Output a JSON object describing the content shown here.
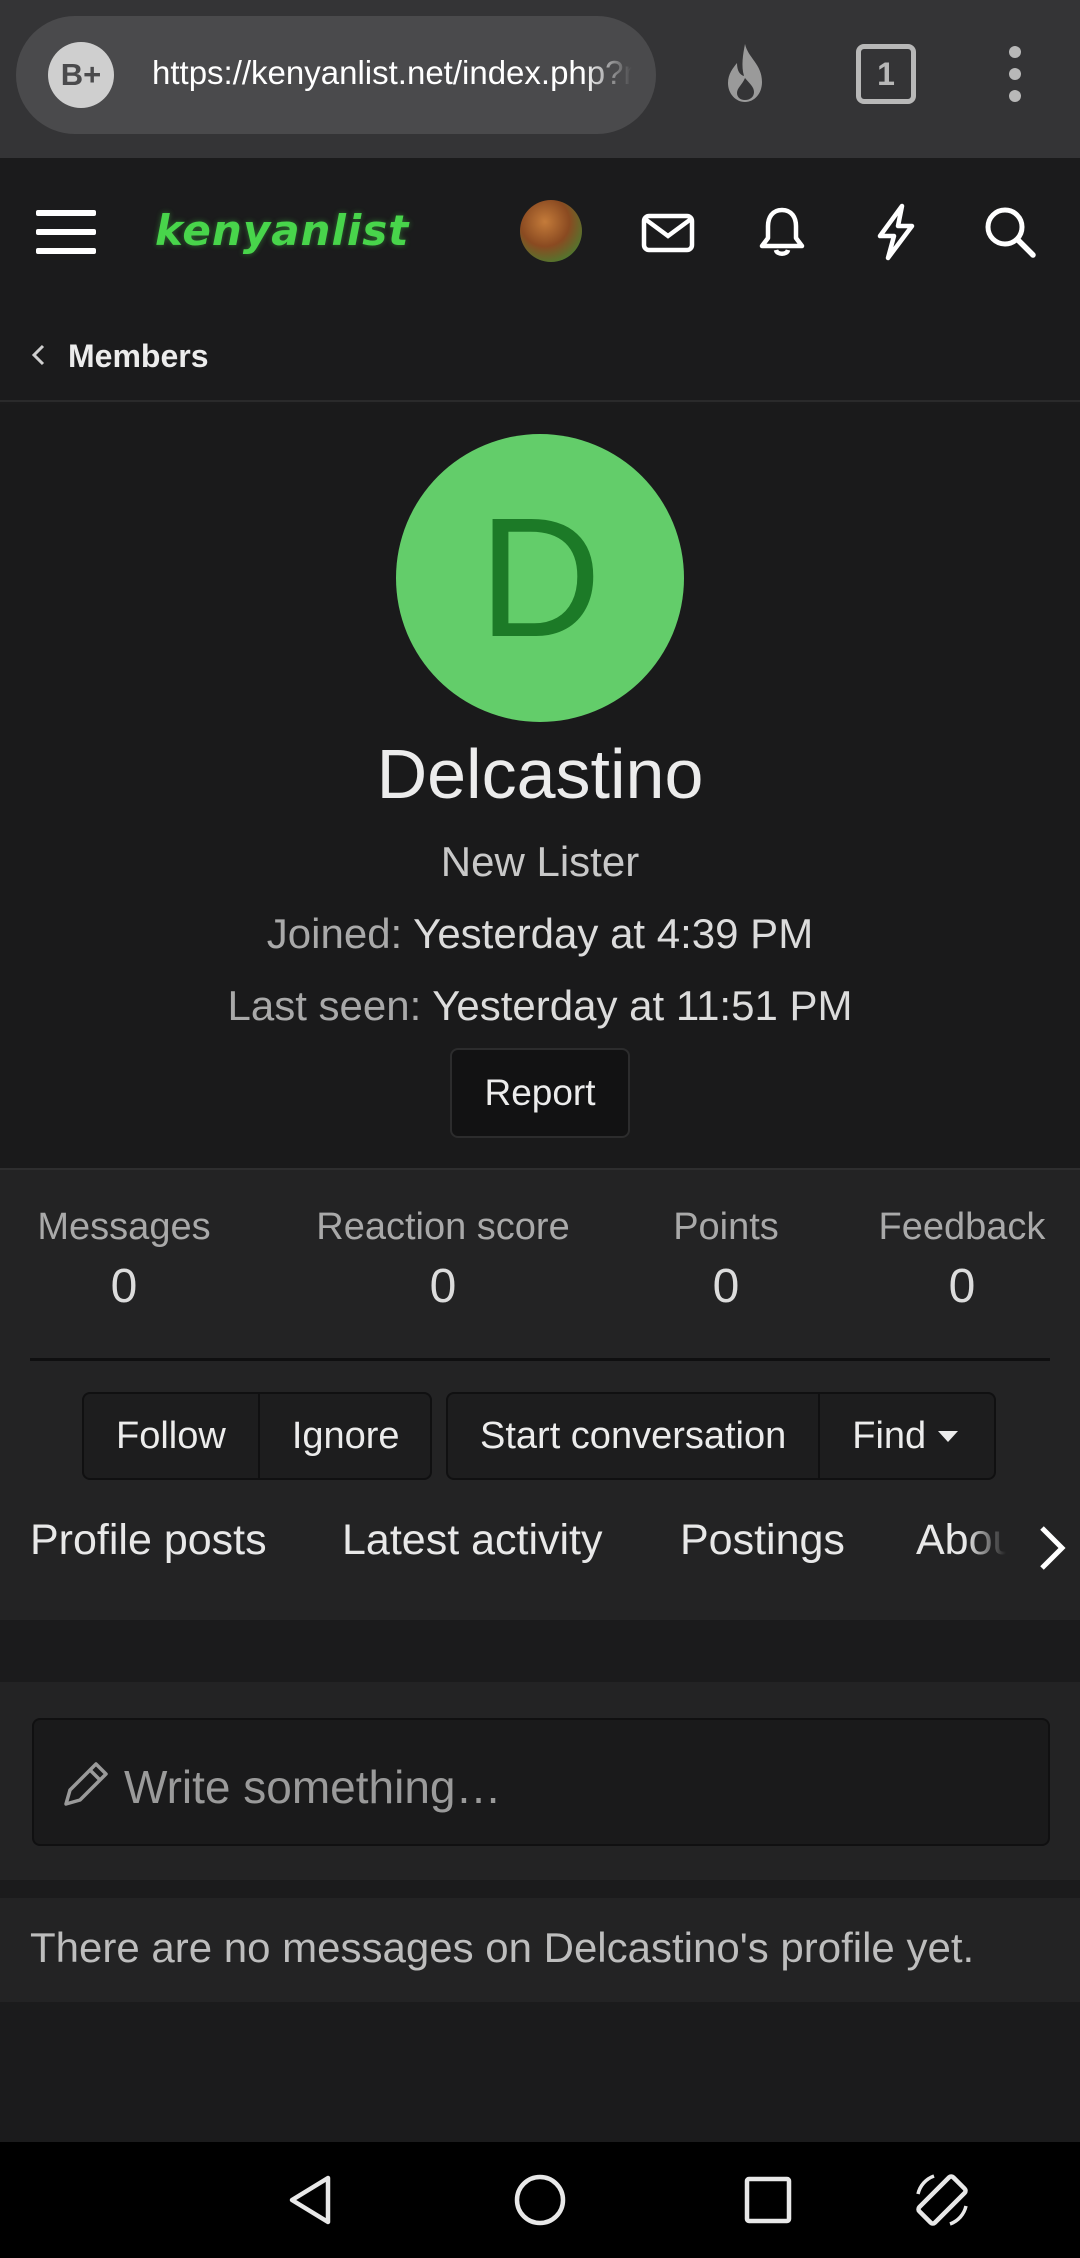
{
  "browser": {
    "badge": "B+",
    "url": "https://kenyanlist.net/index.php?members/delcastino",
    "tab_count": "1"
  },
  "site": {
    "logo": "kenyanlist"
  },
  "breadcrumb": {
    "label": "Members"
  },
  "profile": {
    "avatar_letter": "D",
    "username": "Delcastino",
    "title": "New Lister",
    "joined_label": "Joined:",
    "joined_value": "Yesterday at 4:39 PM",
    "last_seen_label": "Last seen:",
    "last_seen_value": "Yesterday at 11:51 PM",
    "report_label": "Report",
    "avatar_color": "#63cd6a"
  },
  "stats": [
    {
      "label": "Messages",
      "value": "0"
    },
    {
      "label": "Reaction score",
      "value": "0"
    },
    {
      "label": "Points",
      "value": "0"
    },
    {
      "label": "Feedback",
      "value": "0"
    }
  ],
  "actions": {
    "follow": "Follow",
    "ignore": "Ignore",
    "start_conversation": "Start conversation",
    "find": "Find"
  },
  "tabs": [
    {
      "label": "Profile posts"
    },
    {
      "label": "Latest activity"
    },
    {
      "label": "Postings"
    },
    {
      "label": "About"
    }
  ],
  "write": {
    "placeholder": "Write something…"
  },
  "empty_message": "There are no messages on Delcastino's profile yet.",
  "colors": {
    "accent": "#48d54b",
    "background": "#1b1b1c"
  }
}
